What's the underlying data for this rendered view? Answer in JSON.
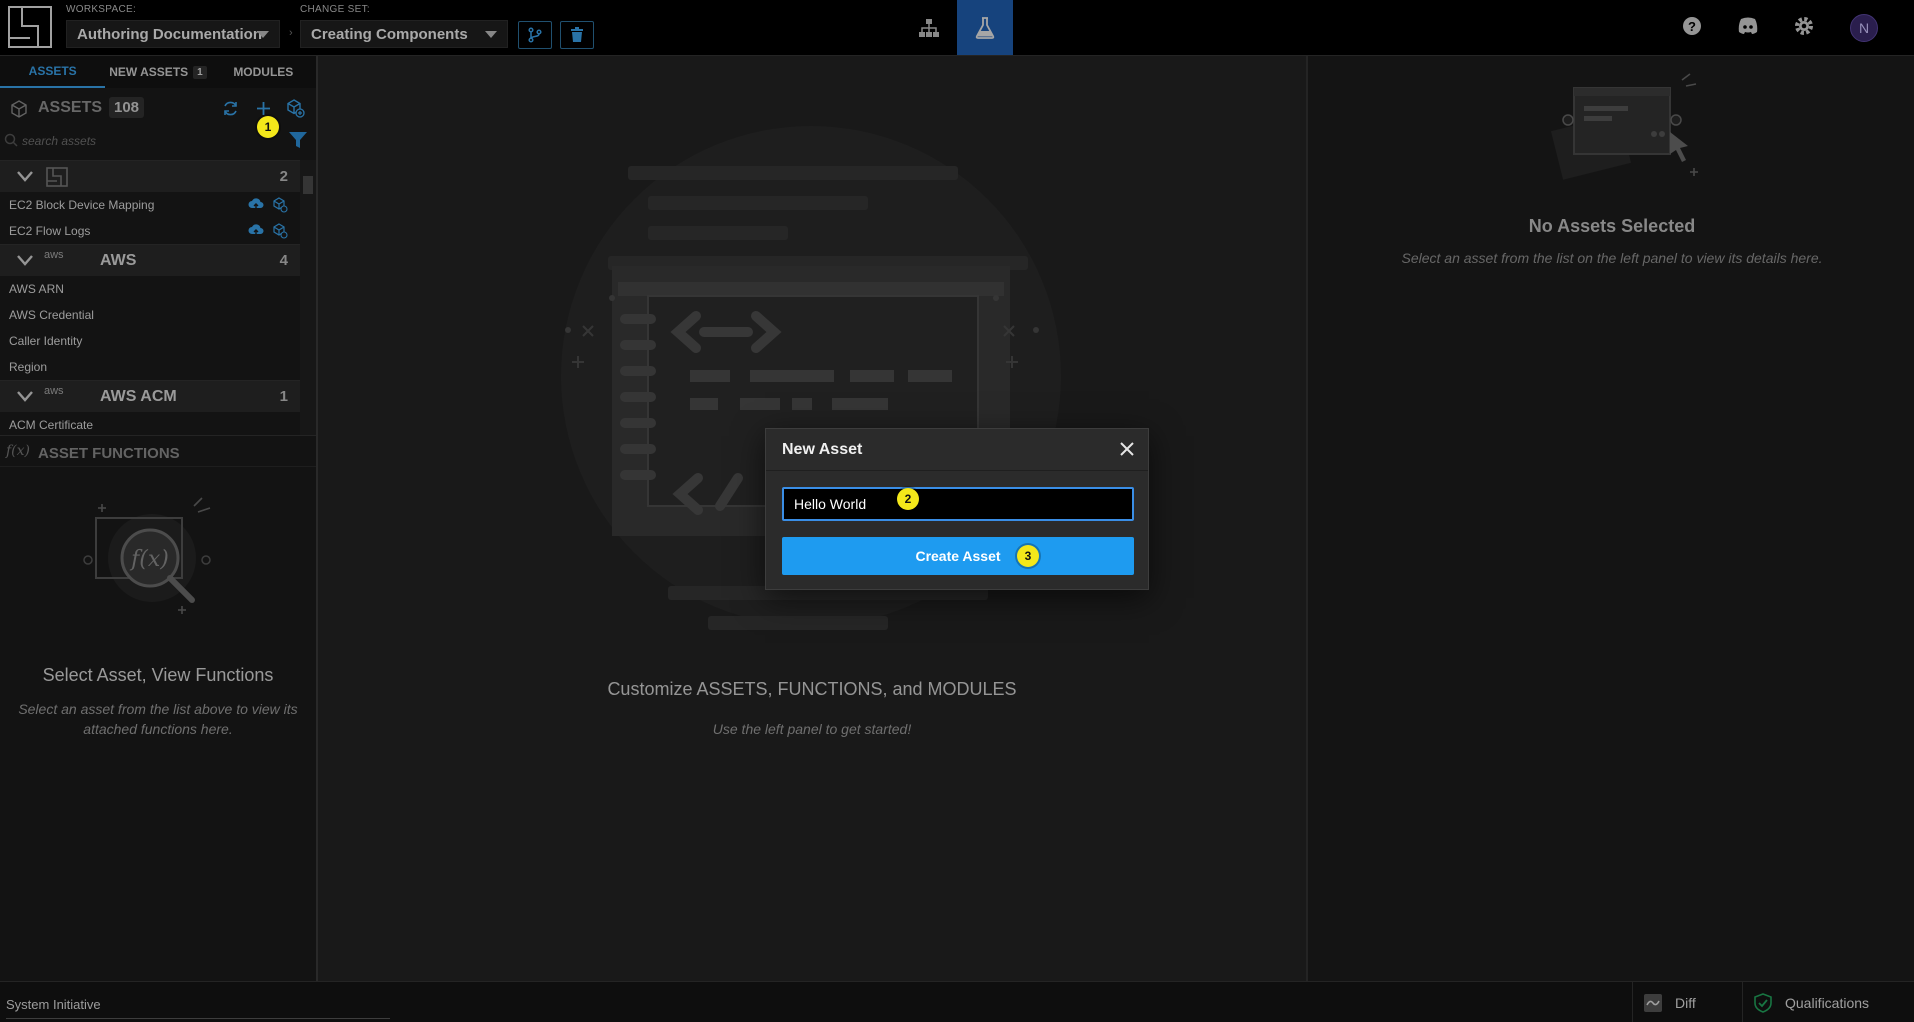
{
  "topbar": {
    "workspace_label": "WORKSPACE:",
    "workspace_value": "Authoring Documentation",
    "changeset_label": "CHANGE SET:",
    "changeset_value": "Creating Components"
  },
  "left": {
    "tabs": [
      {
        "label": "ASSETS"
      },
      {
        "label": "NEW ASSETS",
        "badge": "1"
      },
      {
        "label": "MODULES"
      }
    ],
    "assets_title": "ASSETS",
    "assets_count": "108",
    "search_placeholder": "search assets",
    "groups": [
      {
        "name": "",
        "count": "2",
        "items": [
          "EC2 Block Device Mapping",
          "EC2 Flow Logs"
        ]
      },
      {
        "name": "AWS",
        "logo": "aws",
        "count": "4",
        "items": [
          "AWS ARN",
          "AWS Credential",
          "Caller Identity",
          "Region"
        ]
      },
      {
        "name": "AWS ACM",
        "logo": "aws",
        "count": "1",
        "items": [
          "ACM Certificate"
        ]
      }
    ],
    "functions_title": "ASSET FUNCTIONS",
    "functions_empty_title": "Select Asset, View Functions",
    "functions_empty_sub": "Select an asset from the list above to view its attached functions here."
  },
  "center": {
    "title": "Customize ASSETS, FUNCTIONS, and MODULES",
    "subtitle": "Use the left panel to get started!"
  },
  "right": {
    "title": "No Assets Selected",
    "subtitle": "Select an asset from the list on the left panel to view its details here."
  },
  "modal": {
    "title": "New Asset",
    "input_value": "Hello World",
    "button_label": "Create Asset"
  },
  "steps": [
    "1",
    "2",
    "3"
  ],
  "statusbar": {
    "app_name": "System Initiative",
    "diff_label": "Diff",
    "qualifications_label": "Qualifications"
  },
  "colors": {
    "accent": "#1e9bf0",
    "active_nav": "#1f5eae",
    "step_marker": "#f4e81a",
    "link_icon": "#3aa0e8"
  },
  "icons": [
    "logo-icon",
    "branch-icon",
    "trash-icon",
    "diagram-icon",
    "beaker-icon",
    "help-icon",
    "discord-icon",
    "gear-icon",
    "cube-icon",
    "refresh-icon",
    "plus-icon",
    "new-asset-icon",
    "filter-icon",
    "search-icon",
    "chevron-down-icon",
    "upload-icon",
    "install-icon",
    "function-icon",
    "close-icon",
    "diff-icon",
    "check-shield-icon"
  ]
}
